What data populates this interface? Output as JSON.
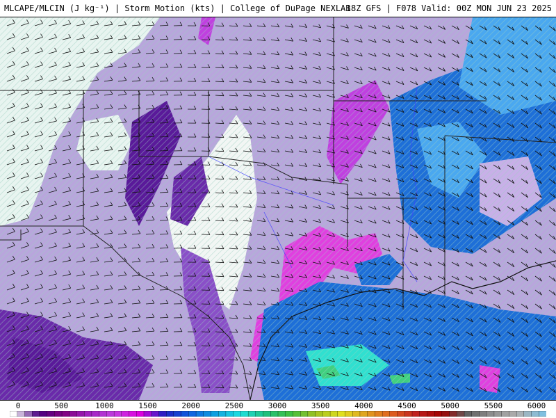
{
  "header": {
    "title": "MLCAPE/MLCIN (J kg⁻¹) | Storm Motion (kts) | College of DuPage NEXLAB",
    "valid": "18Z GFS | F078 Valid: 00Z MON JUN 23 2025"
  },
  "colorbar": {
    "labels": [
      "0",
      "500",
      "1000",
      "1500",
      "2000",
      "2500",
      "3000",
      "3500",
      "4000",
      "4500",
      "5000",
      "5500",
      "6000"
    ],
    "colors": [
      "#ffffff",
      "#4b0082",
      "#800080",
      "#a020c0",
      "#c040e0",
      "#e000e0",
      "#2020c0",
      "#1060e0",
      "#10a0e0",
      "#20e0e0",
      "#20c080",
      "#40c040",
      "#a0c020",
      "#e0e020",
      "#e0a020",
      "#e06020",
      "#c02020",
      "#a00000",
      "#606060",
      "#909090",
      "#b0b0b0",
      "#80c0e0"
    ]
  },
  "map": {
    "region": "South-Central United States",
    "colors": {
      "background": "#b8a6dc",
      "low_cape": "#e8f4f0",
      "mid_purple": "#8a4fc8",
      "deep_purple": "#5a1a9a",
      "magenta": "#e040e0",
      "blue": "#1e6fd8",
      "light_blue": "#4aa8f0",
      "cyan": "#30e0d0",
      "green": "#40d080",
      "border": "#222222",
      "river": "#4040ff"
    }
  }
}
